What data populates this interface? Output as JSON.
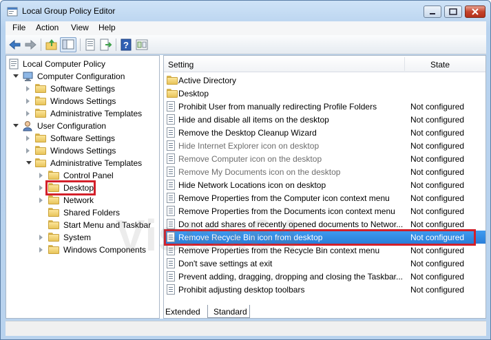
{
  "window": {
    "title": "Local Group Policy Editor"
  },
  "menu": [
    "File",
    "Action",
    "View",
    "Help"
  ],
  "tree": {
    "root": "Local Computer Policy",
    "computer_config": "Computer Configuration",
    "user_config": "User Configuration",
    "software_settings": "Software Settings",
    "windows_settings": "Windows Settings",
    "admin_templates": "Administrative Templates",
    "control_panel": "Control Panel",
    "desktop": "Desktop",
    "network": "Network",
    "shared_folders": "Shared Folders",
    "start_menu": "Start Menu and Taskbar",
    "system": "System",
    "windows_components": "Windows Components"
  },
  "list": {
    "col_setting": "Setting",
    "col_state": "State",
    "folders": [
      "Active Directory",
      "Desktop"
    ],
    "rows": [
      {
        "name": "Prohibit User from manually redirecting Profile Folders",
        "state": "Not configured"
      },
      {
        "name": "Hide and disable all items on the desktop",
        "state": "Not configured"
      },
      {
        "name": "Remove the Desktop Cleanup Wizard",
        "state": "Not configured"
      },
      {
        "name": "Hide Internet Explorer icon on desktop",
        "state": "Not configured"
      },
      {
        "name": "Remove Computer icon on the desktop",
        "state": "Not configured"
      },
      {
        "name": "Remove My Documents icon on the desktop",
        "state": "Not configured"
      },
      {
        "name": "Hide Network Locations icon on desktop",
        "state": "Not configured"
      },
      {
        "name": "Remove Properties from the Computer icon context menu",
        "state": "Not configured"
      },
      {
        "name": "Remove Properties from the Documents icon context menu",
        "state": "Not configured"
      },
      {
        "name": "Do not add shares of recently opened documents to Networ...",
        "state": "Not configured"
      },
      {
        "name": "Remove Recycle Bin icon from desktop",
        "state": "Not configured"
      },
      {
        "name": "Remove Properties from the Recycle Bin context menu",
        "state": "Not configured"
      },
      {
        "name": "Don't save settings at exit",
        "state": "Not configured"
      },
      {
        "name": "Prevent adding, dragging, dropping and closing the Taskbar...",
        "state": "Not configured"
      },
      {
        "name": "Prohibit adjusting desktop toolbars",
        "state": "Not configured"
      }
    ]
  },
  "tabs": [
    "Extended",
    "Standard"
  ],
  "watermark": "Vistax64",
  "colors": {
    "selection": "#2a7fd9",
    "highlight_box": "#d3202a"
  }
}
